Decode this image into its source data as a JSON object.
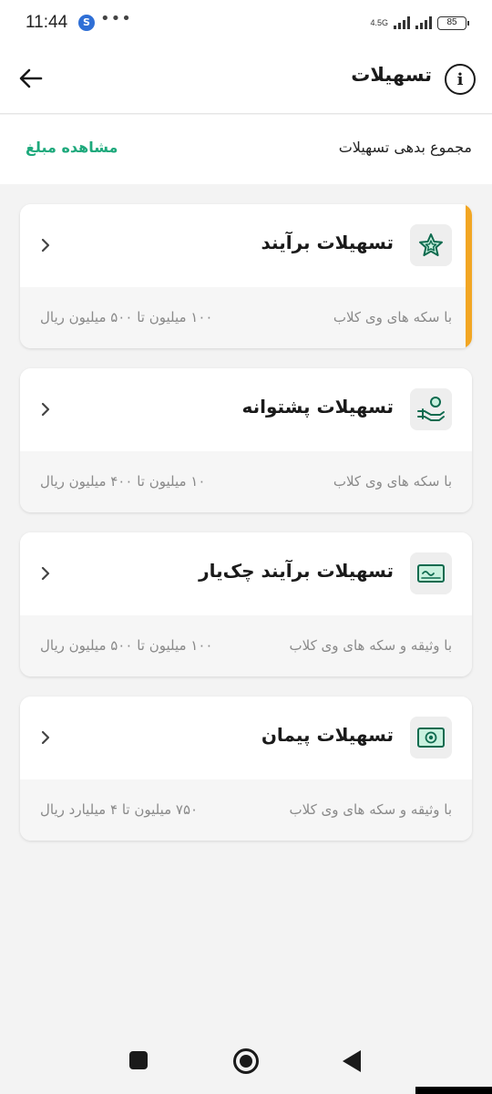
{
  "status_bar": {
    "time": "11:44",
    "network": "4.5G",
    "battery": "85"
  },
  "header": {
    "title": "تسهیلات",
    "info_symbol": "i"
  },
  "debt": {
    "label": "مجموع بدهی تسهیلات",
    "link": "مشاهده مبلغ"
  },
  "cards": [
    {
      "title": "تسهیلات برآیند",
      "subtitle": "با سکه های وی کلاب",
      "range": "۱۰۰ میلیون تا ۵۰۰ میلیون ریال",
      "icon": "star-icon",
      "highlighted": true
    },
    {
      "title": "تسهیلات پشتوانه",
      "subtitle": "با سکه های وی کلاب",
      "range": "۱۰ میلیون تا ۴۰۰ میلیون ریال",
      "icon": "hand-coin-icon"
    },
    {
      "title": "تسهیلات برآیند چک‌یار",
      "subtitle": "با وثیقه و سکه های وی کلاب",
      "range": "۱۰۰ میلیون تا ۵۰۰ میلیون ریال",
      "icon": "cheque-icon"
    },
    {
      "title": "تسهیلات پیمان",
      "subtitle": "با وثیقه و سکه های وی کلاب",
      "range": "۷۵۰ میلیون تا ۴ میلیارد ریال",
      "icon": "banknote-icon"
    }
  ],
  "colors": {
    "accent_green": "#1ea97c",
    "highlight_orange": "#f2a623"
  }
}
